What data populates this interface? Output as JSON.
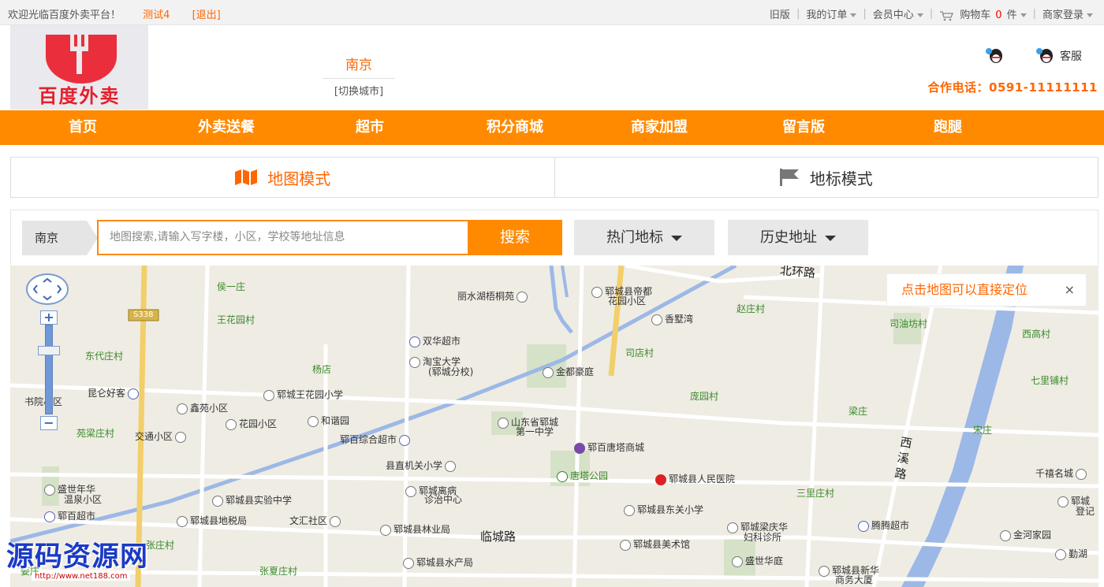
{
  "topbar": {
    "welcome": "欢迎光临百度外卖平台！",
    "user": "测试4",
    "logout": "[退出]",
    "old_version": "旧版",
    "my_orders": "我的订单",
    "member_center": "会员中心",
    "cart_label": "购物车",
    "cart_count": "0",
    "cart_unit": "件",
    "merchant_login": "商家登录"
  },
  "header": {
    "logo_text": "百度外卖",
    "city": "南京",
    "switch_city": "[切换城市]",
    "service": "客服",
    "phone": "合作电话：0591-11111111"
  },
  "nav": [
    "首页",
    "外卖送餐",
    "超市",
    "积分商城",
    "商家加盟",
    "留言版",
    "跑腿"
  ],
  "modes": {
    "map_mode": "地图模式",
    "landmark_mode": "地标模式"
  },
  "search": {
    "city": "南京",
    "placeholder": "地图搜索,请输入写字楼，小区，学校等地址信息",
    "button": "搜索",
    "hot_landmarks": "热门地标",
    "history": "历史地址"
  },
  "map": {
    "tip": "点击地图可以直接定位",
    "tip_close": "×",
    "road_shield": "S338",
    "labels": [
      {
        "t": "侯一庄",
        "c": "green"
      },
      {
        "t": "王花园村",
        "c": "green"
      },
      {
        "t": "东代庄村",
        "c": "green"
      },
      {
        "t": "杨店",
        "c": "green"
      },
      {
        "t": "书院小区",
        "c": ""
      },
      {
        "t": "昆仑好客",
        "c": ""
      },
      {
        "t": "鑫苑小区",
        "c": ""
      },
      {
        "t": "苑梁庄村",
        "c": "green"
      },
      {
        "t": "交通小区",
        "c": ""
      },
      {
        "t": "花园小区",
        "c": ""
      },
      {
        "t": "和谐园",
        "c": ""
      },
      {
        "t": "郓城王花园小学",
        "c": ""
      },
      {
        "t": "郓百综合超市",
        "c": ""
      },
      {
        "t": "县直机关小学",
        "c": ""
      },
      {
        "t": "盛世年华",
        "c": ""
      },
      {
        "t": "温泉小区",
        "c": ""
      },
      {
        "t": "郓城县实验中学",
        "c": ""
      },
      {
        "t": "郓城离病",
        "c": ""
      },
      {
        "t": "诊治中心",
        "c": ""
      },
      {
        "t": "郓百超市",
        "c": ""
      },
      {
        "t": "郓城县地税局",
        "c": ""
      },
      {
        "t": "文汇社区",
        "c": ""
      },
      {
        "t": "郓城县林业局",
        "c": ""
      },
      {
        "t": "张庄村",
        "c": "green"
      },
      {
        "t": "张夏庄村",
        "c": "green"
      },
      {
        "t": "郓城县水产局",
        "c": ""
      },
      {
        "t": "姜庄",
        "c": "green"
      },
      {
        "t": "丽水湖梧桐苑",
        "c": ""
      },
      {
        "t": "双华超市",
        "c": ""
      },
      {
        "t": "淘宝大学",
        "c": ""
      },
      {
        "t": "(郓城分校)",
        "c": ""
      },
      {
        "t": "郓城县帝都",
        "c": ""
      },
      {
        "t": "花园小区",
        "c": ""
      },
      {
        "t": "香墅湾",
        "c": ""
      },
      {
        "t": "司店村",
        "c": "green"
      },
      {
        "t": "金都豪庭",
        "c": ""
      },
      {
        "t": "山东省郓城",
        "c": ""
      },
      {
        "t": "第一中学",
        "c": ""
      },
      {
        "t": "郓百唐塔商城",
        "c": ""
      },
      {
        "t": "唐塔公园",
        "c": ""
      },
      {
        "t": "郓城县人民医院",
        "c": ""
      },
      {
        "t": "郓城县东关小学",
        "c": ""
      },
      {
        "t": "郓城梁庆华",
        "c": ""
      },
      {
        "t": "妇科诊所",
        "c": ""
      },
      {
        "t": "郓城县美术馆",
        "c": ""
      },
      {
        "t": "盛世华庭",
        "c": ""
      },
      {
        "t": "郓城县新华",
        "c": ""
      },
      {
        "t": "商务大厦",
        "c": ""
      },
      {
        "t": "赵庄村",
        "c": "green"
      },
      {
        "t": "庞园村",
        "c": "green"
      },
      {
        "t": "梁庄",
        "c": "green"
      },
      {
        "t": "三里庄村",
        "c": "green"
      },
      {
        "t": "腾腾超市",
        "c": ""
      },
      {
        "t": "司油坊村",
        "c": "green"
      },
      {
        "t": "西高村",
        "c": "green"
      },
      {
        "t": "七里铺村",
        "c": "green"
      },
      {
        "t": "宋庄",
        "c": "green"
      },
      {
        "t": "千禧名城",
        "c": ""
      },
      {
        "t": "郓城",
        "c": ""
      },
      {
        "t": "登记",
        "c": ""
      },
      {
        "t": "金河家园",
        "c": ""
      },
      {
        "t": "勤湖",
        "c": ""
      },
      {
        "t": "北环路",
        "c": "road"
      },
      {
        "t": "临城路",
        "c": "road"
      },
      {
        "t": "西溪路",
        "c": "road"
      }
    ]
  },
  "watermark": {
    "brand": "源码资源网",
    "url": "http://www.net188.com"
  }
}
